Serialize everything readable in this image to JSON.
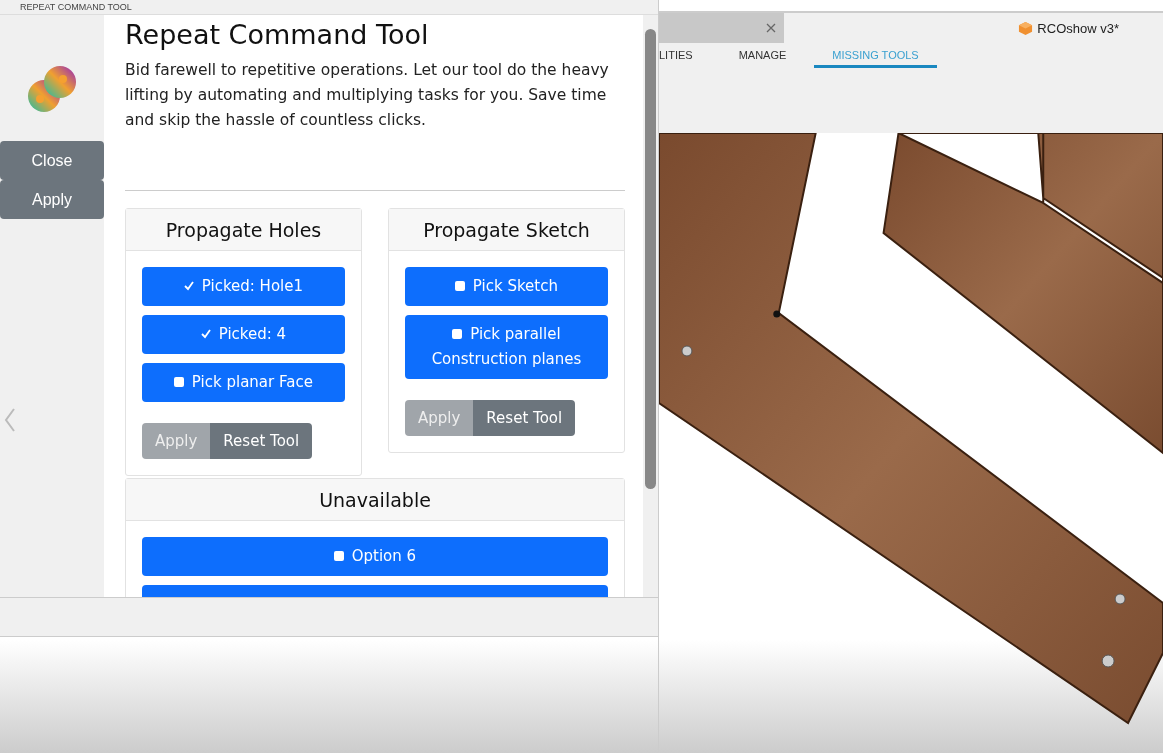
{
  "window": {
    "title": "REPEAT COMMAND TOOL"
  },
  "sidebar": {
    "buttons": [
      "Close",
      "Apply"
    ]
  },
  "header": {
    "title": "Repeat Command Tool",
    "description": "Bid farewell to repetitive operations. Let our tool do the heavy lifting by automating and multiplying tasks for you. Save time and skip the hassle of countless clicks."
  },
  "cards": [
    {
      "title": "Propagate Holes",
      "picks": [
        {
          "label": "Picked: Hole1",
          "checked": true
        },
        {
          "label": "Picked: 4",
          "checked": true
        },
        {
          "label": "Pick planar Face",
          "checked": false
        }
      ],
      "actions": [
        {
          "label": "Apply",
          "disabled": true
        },
        {
          "label": "Reset Tool",
          "disabled": false
        }
      ]
    },
    {
      "title": "Propagate Sketch",
      "picks": [
        {
          "label": "Pick Sketch",
          "checked": false
        },
        {
          "label": "Pick parallel Construction planes",
          "checked": false
        }
      ],
      "actions": [
        {
          "label": "Apply",
          "disabled": true
        },
        {
          "label": "Reset Tool",
          "disabled": false
        }
      ]
    }
  ],
  "unavailable": {
    "title": "Unavailable",
    "picks": [
      {
        "label": "Option 6",
        "checked": false
      }
    ]
  },
  "app": {
    "document_title": "RCOshow v3*",
    "tabs": [
      {
        "label": "LITIES",
        "selected": false
      },
      {
        "label": "MANAGE",
        "selected": false
      },
      {
        "label": "MISSING TOOLS",
        "selected": true
      }
    ]
  }
}
